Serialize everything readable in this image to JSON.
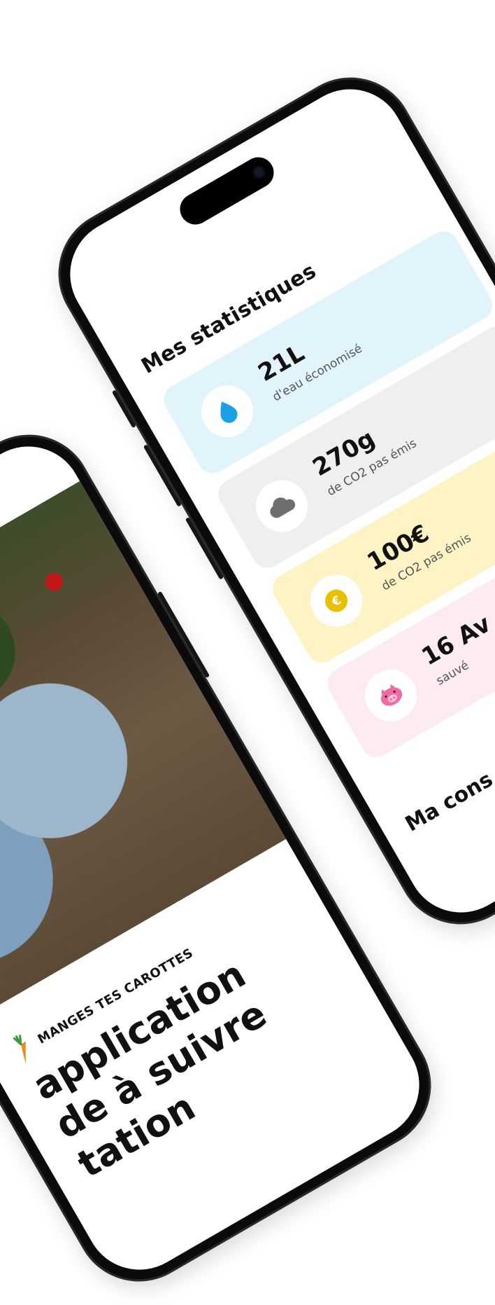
{
  "stats_screen": {
    "title": "Mes statistiques",
    "cards": [
      {
        "value": "21L",
        "label": "d'eau économisé",
        "icon": "water-drop-icon",
        "bg": "#e2f4fb",
        "accent": "#1aa0e6"
      },
      {
        "value": "270g",
        "label": "de CO2 pas émis",
        "icon": "cloud-icon",
        "bg": "#efefef",
        "accent": "#6e6e6e"
      },
      {
        "value": "100€",
        "label": "de CO2 pas émis",
        "icon": "euro-coin-icon",
        "bg": "#fdf3c4",
        "accent": "#e8c000"
      },
      {
        "value": "16 Av",
        "label": "sauvé",
        "icon": "pig-icon",
        "bg": "#fcebf1",
        "accent": "#f06aa4"
      }
    ],
    "section2_title": "Ma cons"
  },
  "onboarding_screen": {
    "brand": "MANGES TES CAROTTES",
    "brand_icon": "carrot-icon",
    "headline_lines": [
      "application",
      "de à suivre",
      "tation"
    ]
  }
}
